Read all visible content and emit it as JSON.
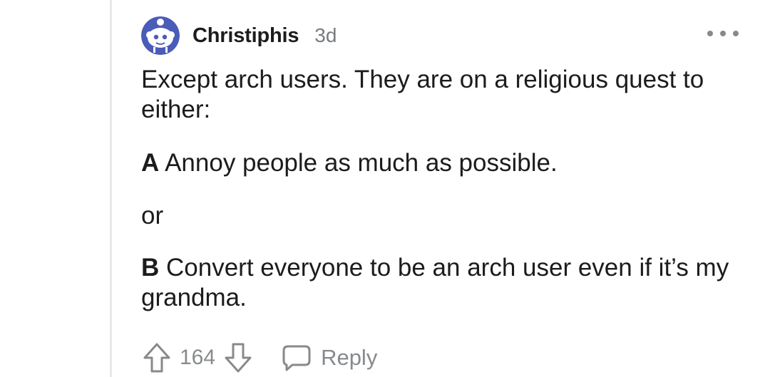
{
  "comment": {
    "author": "Christiphis",
    "age": "3d",
    "avatar_icon": "reddit-snoo-avatar-icon",
    "more_icon": "more-options-icon",
    "accent_color": "#4a5cb8",
    "paragraphs": {
      "p1": "Except arch users. They are on a religious quest to either:",
      "p2_letter": "A",
      "p2_text": " Annoy people as much as possible.",
      "p3": "or",
      "p4_letter": "B",
      "p4_text": " Convert everyone to be an arch user even if it’s my grandma."
    },
    "actions": {
      "upvote_icon": "upvote-arrow-icon",
      "score": "164",
      "downvote_icon": "downvote-arrow-icon",
      "reply_icon": "reply-bubble-icon",
      "reply_label": "Reply"
    }
  }
}
